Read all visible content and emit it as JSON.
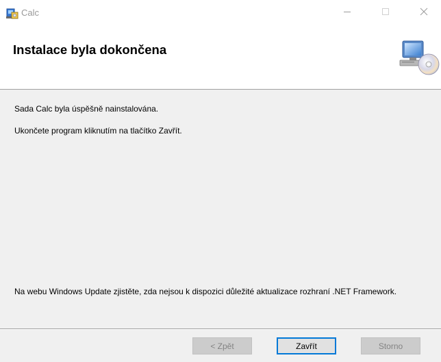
{
  "window": {
    "title": "Calc",
    "controls": {
      "minimize_icon": "minimize-icon",
      "maximize_icon": "maximize-icon",
      "close_icon": "close-icon"
    }
  },
  "header": {
    "title": "Instalace byla dokončena",
    "graphic_icon": "computer-cd-icon"
  },
  "body": {
    "message1": "Sada Calc byla úspěšně nainstalována.",
    "message2": "Ukončete program kliknutím na tlačítko Zavřít.",
    "message3": "Na webu Windows Update zjistěte, zda nejsou k dispozici důležité aktualizace rozhraní .NET Framework."
  },
  "buttons": {
    "back_label": "< Zpět",
    "close_label": "Zavřít",
    "cancel_label": "Storno"
  },
  "colors": {
    "accent": "#0078d7",
    "disabled_text": "#838383",
    "background": "#f0f0f0"
  }
}
